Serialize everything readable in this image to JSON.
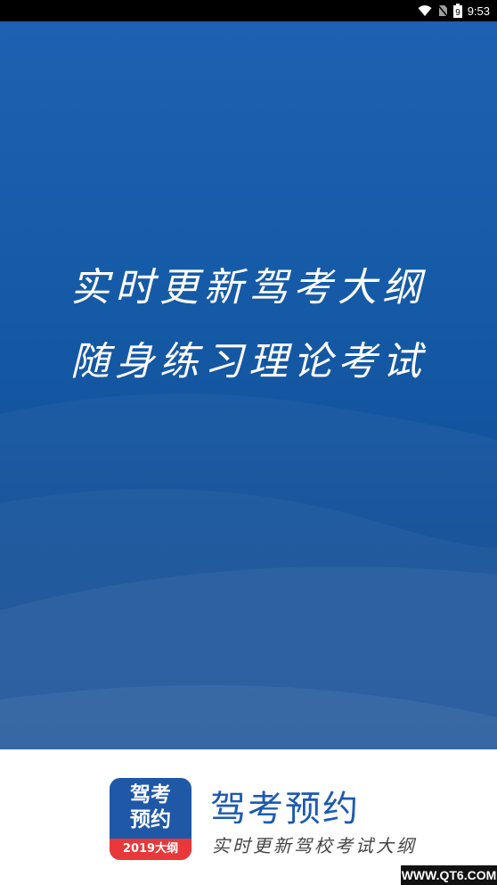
{
  "status_bar": {
    "time": "9:53",
    "battery_level": "9",
    "icons": [
      "wifi-icon",
      "no-sim-icon",
      "battery-icon"
    ]
  },
  "hero": {
    "slogan_line1": "实时更新驾考大纲",
    "slogan_line2": "随身练习理论考试",
    "colors": {
      "top": "#1d61b2",
      "bottom": "#0f4a92"
    }
  },
  "footer": {
    "logo": {
      "line1": "驾考",
      "line2": "预约",
      "band": "2019大纲"
    },
    "title": "驾考预约",
    "subtitle": "实时更新驾校考试大纲",
    "watermark": "WWW.QT6.COM",
    "colors": {
      "brand_blue": "#1d5ab0",
      "band_red": "#e8383a"
    }
  }
}
